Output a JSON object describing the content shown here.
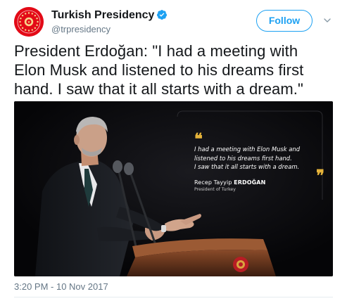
{
  "account": {
    "display_name": "Turkish Presidency",
    "handle": "@trpresidency",
    "verified": true,
    "verified_icon": "verified-badge-icon",
    "avatar_icon": "turkish-presidential-seal-icon"
  },
  "actions": {
    "follow_label": "Follow",
    "more_icon": "chevron-down-icon"
  },
  "tweet": {
    "text_lines": [
      "President Erdoğan: \"I had a meeting with",
      "Elon Musk and listened to his dreams first",
      "hand. I saw that it all starts with a dream.\""
    ],
    "timestamp": "3:20 PM - 10 Nov 2017"
  },
  "media": {
    "quote_lines": [
      "I had a meeting with Elon Musk and",
      "listened to his dreams first hand.",
      "I saw that it all starts with a dream."
    ],
    "quote_open": "❝",
    "quote_close": "❞",
    "author_prefix": "Recep Tayyip ",
    "author_surname": "ERDOĞAN",
    "author_title": "President of Turkey"
  },
  "colors": {
    "accent": "#1da1f2",
    "text": "#14171a",
    "secondary": "#657786",
    "quote_gold": "#e5b33a",
    "avatar_red": "#e30a17"
  }
}
